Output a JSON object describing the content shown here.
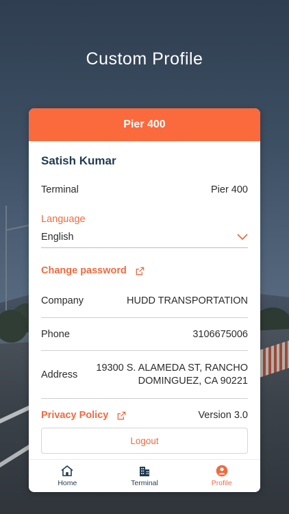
{
  "screen_title": "Custom Profile",
  "card": {
    "header": "Pier 400",
    "user_name": "Satish Kumar",
    "terminal": {
      "label": "Terminal",
      "value": "Pier 400"
    },
    "language": {
      "label": "Language",
      "value": "English"
    },
    "change_password": "Change password",
    "company": {
      "label": "Company",
      "value": "HUDD TRANSPORTATION"
    },
    "phone": {
      "label": "Phone",
      "value": "3106675006"
    },
    "address": {
      "label": "Address",
      "line1": "19300 S. ALAMEDA ST, RANCHO",
      "line2": "DOMINGUEZ, CA 90221"
    },
    "privacy_policy": "Privacy Policy",
    "version": "Version 3.0",
    "logout": "Logout"
  },
  "tabs": [
    {
      "label": "Home",
      "icon": "home-icon"
    },
    {
      "label": "Terminal",
      "icon": "building-icon"
    },
    {
      "label": "Profile",
      "icon": "profile-icon",
      "active": true
    }
  ],
  "colors": {
    "accent": "#fb6a3d",
    "link": "#f06a3f",
    "name": "#1f3a52"
  }
}
